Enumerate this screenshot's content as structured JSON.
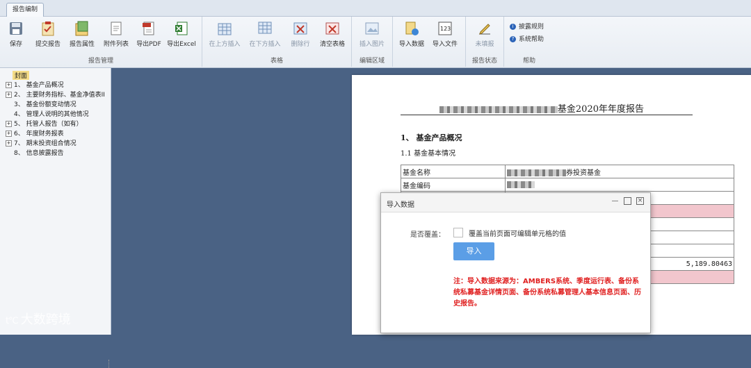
{
  "ribbon": {
    "tab": "报告编制",
    "groups": {
      "report_mgmt": {
        "label": "报告管理",
        "buttons": [
          "保存",
          "提交报告",
          "报告属性",
          "附件列表",
          "导出PDF",
          "导出Excel"
        ]
      },
      "table": {
        "label": "表格",
        "buttons": [
          "在上方插入",
          "在下方插入",
          "删除行",
          "清空表格"
        ]
      },
      "edit_area": {
        "label": "编辑区域",
        "buttons": [
          "插入图片"
        ]
      },
      "import": {
        "buttons": [
          "导入数据",
          "导入文件"
        ]
      },
      "report_status": {
        "label": "报告状态",
        "buttons": [
          "未填报"
        ]
      },
      "help": {
        "label": "帮助",
        "items": [
          "披露规则",
          "系统帮助"
        ]
      }
    }
  },
  "tree": {
    "root": "封面",
    "items": [
      {
        "num": "1、",
        "label": "基金产品概况",
        "expandable": true
      },
      {
        "num": "2、",
        "label": "主要财务指标、基金净值表II",
        "expandable": true
      },
      {
        "num": "3、",
        "label": "基金份额变动情况",
        "expandable": false
      },
      {
        "num": "4、",
        "label": "管理人说明的其他情况",
        "expandable": false
      },
      {
        "num": "5、",
        "label": "托管人报告（如有）",
        "expandable": true
      },
      {
        "num": "6、",
        "label": "年度财务报表",
        "expandable": true
      },
      {
        "num": "7、",
        "label": "期末投资组合情况",
        "expandable": true
      },
      {
        "num": "8、",
        "label": "信息披露报告",
        "expandable": false
      }
    ]
  },
  "document": {
    "title_suffix": "基金2020年年度报告",
    "section1": "1、  基金产品概况",
    "section1_1": "1.1 基金基本情况",
    "rows": [
      {
        "label": "基金名称",
        "value_suffix": "券投资基金"
      },
      {
        "label": "基金编码",
        "value_suffix": ""
      }
    ],
    "visible_value": "5,189.80463"
  },
  "dialog": {
    "title": "导入数据",
    "overwrite_label": "是否覆盖：",
    "overwrite_text": "覆盖当前页面可编辑单元格的值",
    "button": "导入",
    "note": "注：导入数据来源为：AMBERS系统、季度运行表、备份系统私募基金详情页面、备份系统私募管理人基本信息页面、历史报告。"
  },
  "watermark": "大数跨境"
}
